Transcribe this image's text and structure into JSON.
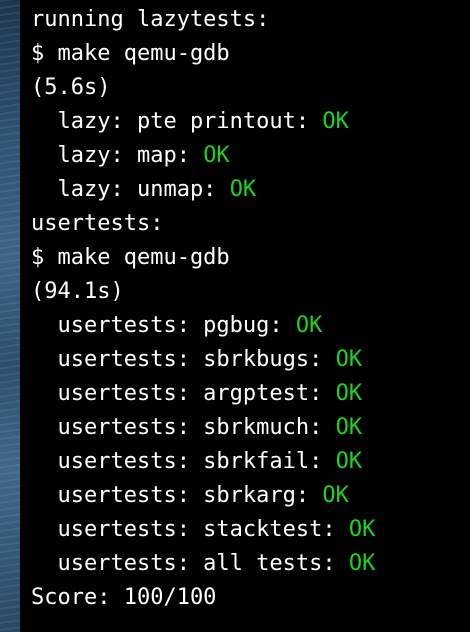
{
  "terminal": {
    "lines": [
      {
        "text": "running lazytests:",
        "status": ""
      },
      {
        "text": "$ make qemu-gdb",
        "status": ""
      },
      {
        "text": "(5.6s)",
        "status": ""
      },
      {
        "text": "  lazy: pte printout: ",
        "status": "OK"
      },
      {
        "text": "  lazy: map: ",
        "status": "OK"
      },
      {
        "text": "  lazy: unmap: ",
        "status": "OK"
      },
      {
        "text": "usertests:",
        "status": ""
      },
      {
        "text": "$ make qemu-gdb",
        "status": ""
      },
      {
        "text": "(94.1s)",
        "status": ""
      },
      {
        "text": "  usertests: pgbug: ",
        "status": "OK"
      },
      {
        "text": "  usertests: sbrkbugs: ",
        "status": "OK"
      },
      {
        "text": "  usertests: argptest: ",
        "status": "OK"
      },
      {
        "text": "  usertests: sbrkmuch: ",
        "status": "OK"
      },
      {
        "text": "  usertests: sbrkfail: ",
        "status": "OK"
      },
      {
        "text": "  usertests: sbrkarg: ",
        "status": "OK"
      },
      {
        "text": "  usertests: stacktest: ",
        "status": "OK"
      },
      {
        "text": "  usertests: all tests: ",
        "status": "OK"
      },
      {
        "text": "Score: 100/100",
        "status": ""
      }
    ]
  },
  "colors": {
    "background": "#000000",
    "text": "#ffffff",
    "ok": "#1ed31e"
  }
}
